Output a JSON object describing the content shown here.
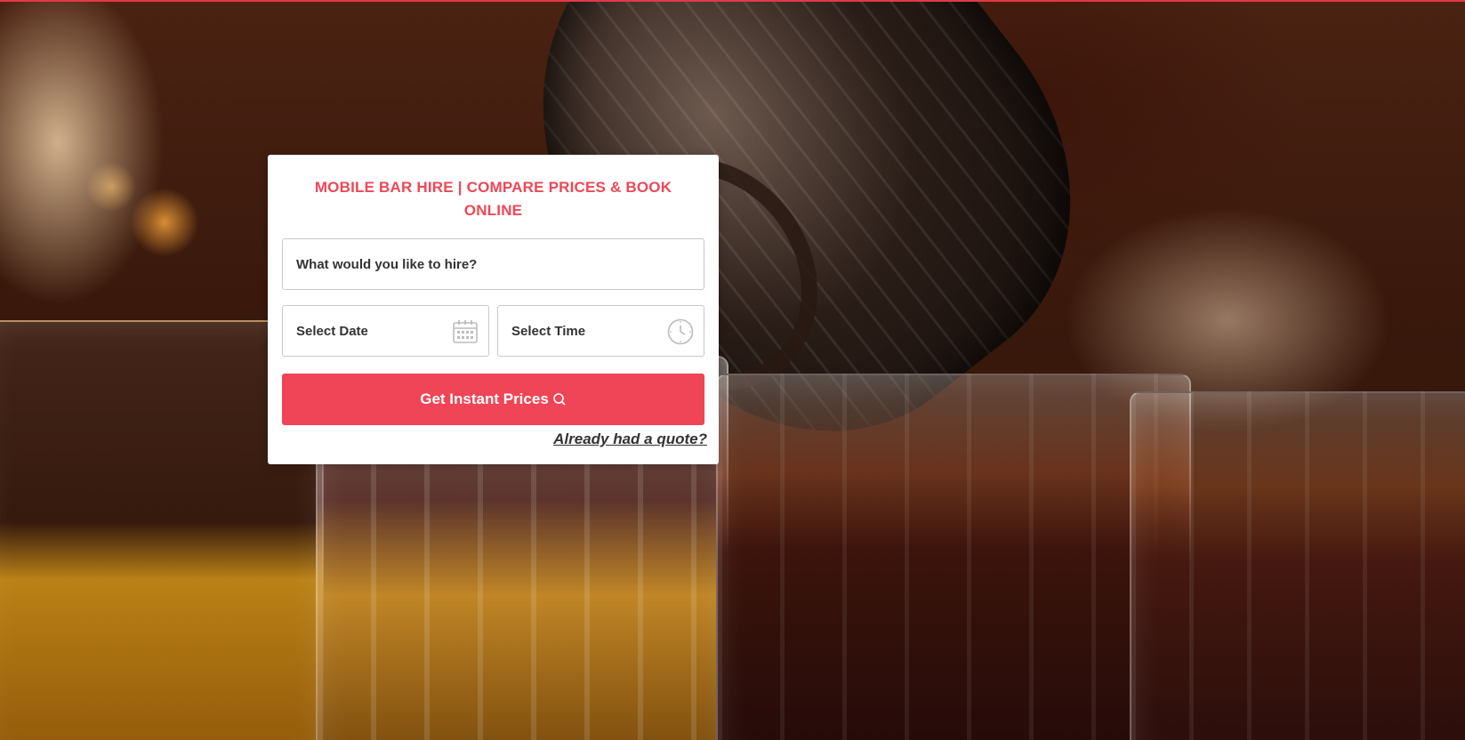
{
  "search_card": {
    "title": "MOBILE BAR HIRE | COMPARE PRICES & BOOK ONLINE",
    "hire_placeholder": "What would you like to hire?",
    "date_placeholder": "Select Date",
    "time_placeholder": "Select Time",
    "submit_label": "Get Instant Prices",
    "quote_link": "Already had a quote?"
  },
  "icons": {
    "date": "calendar-icon",
    "time": "clock-icon",
    "submit": "search-icon"
  },
  "colors": {
    "accent": "#ef4556",
    "title": "#ef4756",
    "card": "#ffffff",
    "text": "#333333"
  }
}
